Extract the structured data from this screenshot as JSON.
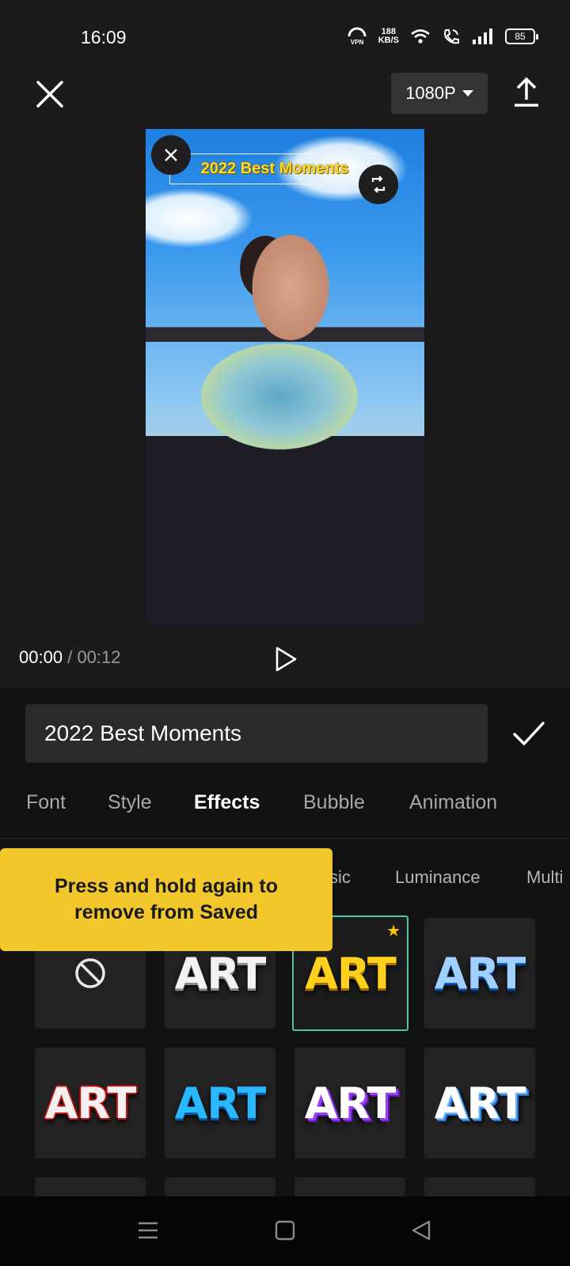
{
  "status_bar": {
    "time": "16:09",
    "vpn_label": "VPN",
    "speed_value": "188",
    "speed_unit": "KB/S",
    "battery": "85"
  },
  "toolbar": {
    "resolution": "1080P"
  },
  "preview": {
    "overlay_text": "2022 Best Moments"
  },
  "playback": {
    "current_time": "00:00",
    "separator": "/",
    "total_time": "00:12"
  },
  "editor": {
    "text_value": "2022 Best Moments"
  },
  "tabs": [
    {
      "label": "Font"
    },
    {
      "label": "Style"
    },
    {
      "label": "Effects"
    },
    {
      "label": "Bubble"
    },
    {
      "label": "Animation"
    }
  ],
  "subtabs": [
    {
      "label": "sic"
    },
    {
      "label": "Luminance"
    },
    {
      "label": "Multi"
    }
  ],
  "tooltip": {
    "line1": "Press and hold again to",
    "line2": "remove from Saved"
  },
  "effects": [
    {
      "label": "ART",
      "style": "white"
    },
    {
      "label": "ART",
      "style": "gold"
    },
    {
      "label": "ART",
      "style": "chrome"
    },
    {
      "label": "ART",
      "style": "red"
    },
    {
      "label": "ART",
      "style": "cyan"
    },
    {
      "label": "ART",
      "style": "purple"
    },
    {
      "label": "ART",
      "style": "blue3d"
    }
  ],
  "colors": {
    "accent_selected": "#4fc3a7",
    "tooltip_bg": "#f2c72b",
    "saved_star": "#ffc400"
  }
}
